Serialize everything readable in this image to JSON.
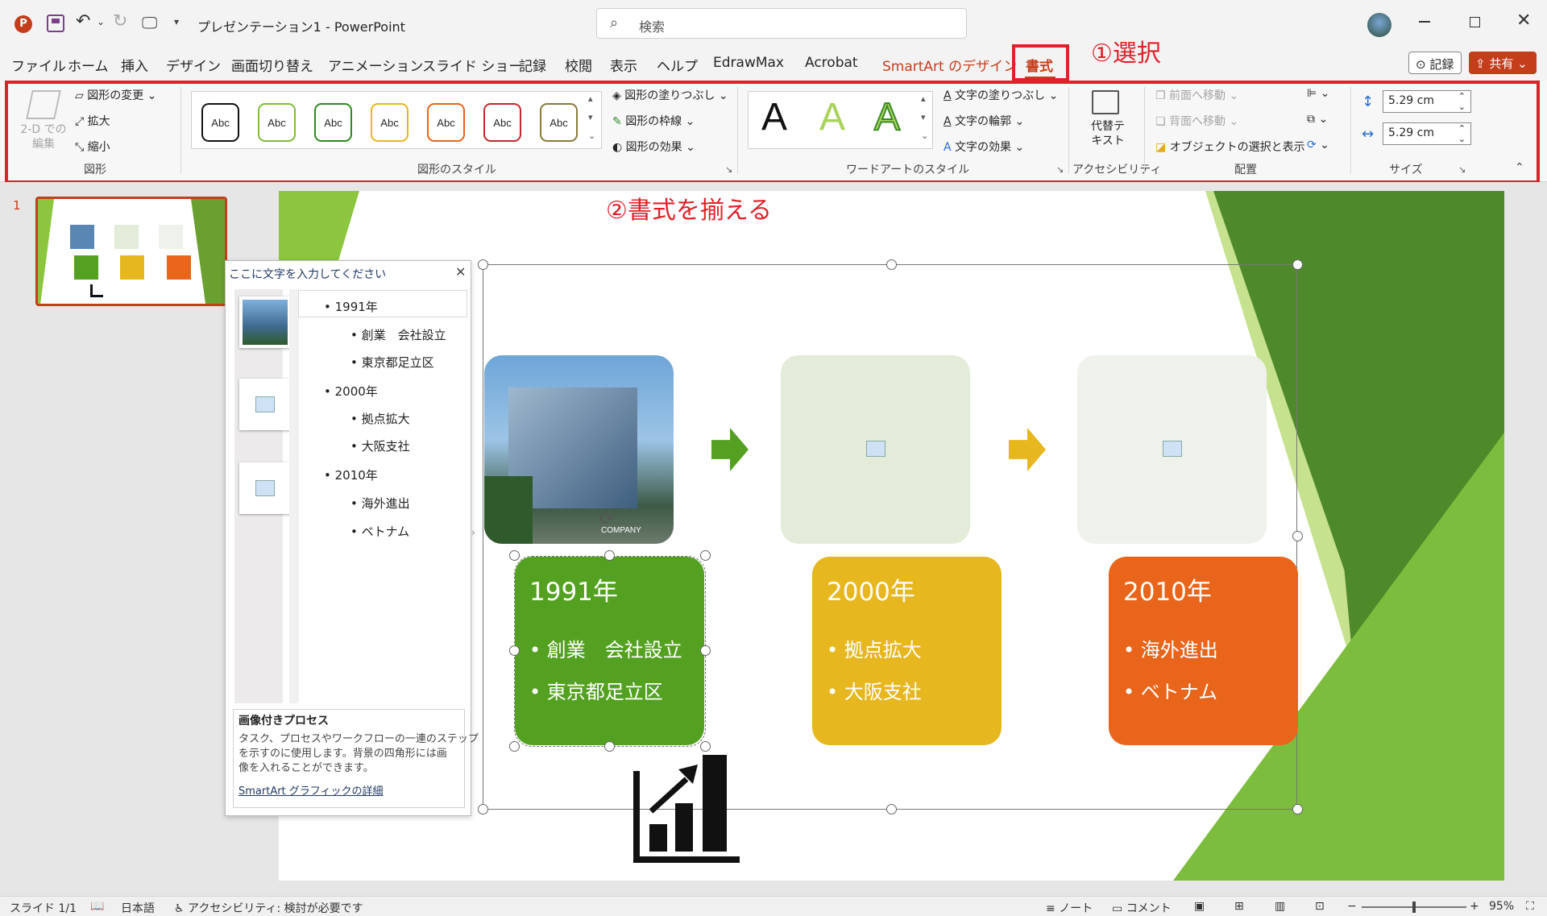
{
  "app": {
    "doc_title": "プレゼンテーション1",
    "app_name": "PowerPoint",
    "search_placeholder": "検索"
  },
  "menu": {
    "items": [
      "ファイル",
      "ホーム",
      "挿入",
      "デザイン",
      "画面切り替え",
      "アニメーション",
      "スライド ショー",
      "記録",
      "校閲",
      "表示",
      "ヘルプ",
      "EdrawMax",
      "Acrobat",
      "SmartArt のデザイン",
      "書式"
    ],
    "active": "書式",
    "record_label": "記録",
    "share_label": "共有"
  },
  "annotations": {
    "a1": "①選択",
    "a2": "②書式を揃える"
  },
  "ribbon": {
    "shapes": {
      "edit2d": "2-D での編集",
      "change": "図形の変更",
      "enlarge": "拡大",
      "shrink": "縮小",
      "group": "図形"
    },
    "styles": {
      "abc": "Abc",
      "fill": "図形の塗りつぶし",
      "outline": "図形の枠線",
      "effects": "図形の効果",
      "group": "図形のスタイル"
    },
    "wordart": {
      "letter": "A",
      "fill": "文字の塗りつぶし",
      "outline": "文字の輪郭",
      "effects": "文字の効果",
      "group": "ワードアートのスタイル"
    },
    "access": {
      "alt": "代替テキスト",
      "group": "アクセシビリティ"
    },
    "arrange": {
      "front": "前面へ移動",
      "back": "背面へ移動",
      "selpane": "オブジェクトの選択と表示",
      "group": "配置"
    },
    "size": {
      "height": "5.29 cm",
      "width": "5.29 cm",
      "group": "サイズ"
    }
  },
  "thumb": {
    "number": "1"
  },
  "text_pane": {
    "title": "ここに文字を入力してください",
    "items": [
      {
        "level": 1,
        "text": "1991年"
      },
      {
        "level": 2,
        "text": "創業　会社設立"
      },
      {
        "level": 2,
        "text": "東京都足立区"
      },
      {
        "level": 1,
        "text": "2000年"
      },
      {
        "level": 2,
        "text": "拠点拡大"
      },
      {
        "level": 2,
        "text": "大阪支社"
      },
      {
        "level": 1,
        "text": "2010年"
      },
      {
        "level": 2,
        "text": "海外進出"
      },
      {
        "level": 2,
        "text": "ベトナム"
      }
    ],
    "desc_title": "画像付きプロセス",
    "desc_lines": [
      "タスク、プロセスやワークフローの一連のステップ",
      "を示すのに使用します。背景の四角形には画",
      "像を入れることができます。"
    ],
    "link": "SmartArt グラフィックの詳細"
  },
  "smartart": {
    "company_sign": "COMPANY",
    "cards": [
      {
        "year": "1991年",
        "b1": "創業　会社設立",
        "b2": "東京都足立区",
        "color": "#54a121"
      },
      {
        "year": "2000年",
        "b1": "拠点拡大",
        "b2": "大阪支社",
        "color": "#e6b71f"
      },
      {
        "year": "2010年",
        "b1": "海外進出",
        "b2": "ベトナム",
        "color": "#e8651b"
      }
    ]
  },
  "status": {
    "slide": "スライド 1/1",
    "lang": "日本語",
    "access": "アクセシビリティ: 検討が必要です",
    "notes": "ノート",
    "comments": "コメント",
    "zoom": "95%"
  }
}
